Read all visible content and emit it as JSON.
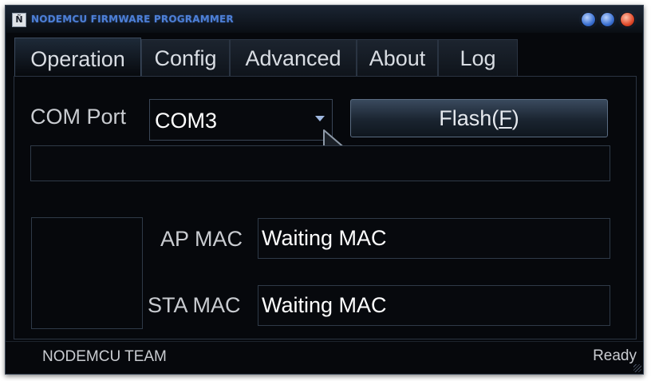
{
  "window": {
    "title": "NODEMCU FIRMWARE PROGRAMMER",
    "icon_label": "Ñ",
    "controls": [
      "minimize-icon",
      "maximize-icon",
      "close-icon"
    ],
    "accent_color": "#4d7fd6",
    "background_color": "#06080c"
  },
  "tabs": [
    {
      "label": "Operation",
      "active": true
    },
    {
      "label": "Config",
      "active": false
    },
    {
      "label": "Advanced",
      "active": false
    },
    {
      "label": "About",
      "active": false
    },
    {
      "label": "Log",
      "active": false
    }
  ],
  "operation": {
    "com_port_label": "COM Port",
    "com_port_value": "COM3",
    "flash_button": {
      "text": "Flash(",
      "mnemonic": "F",
      "suffix": ")"
    },
    "ap_mac_label": "AP MAC",
    "ap_mac_value": "Waiting MAC",
    "sta_mac_label": "STA MAC",
    "sta_mac_value": "Waiting MAC"
  },
  "statusbar": {
    "left": "NODEMCU TEAM",
    "right": "Ready"
  }
}
